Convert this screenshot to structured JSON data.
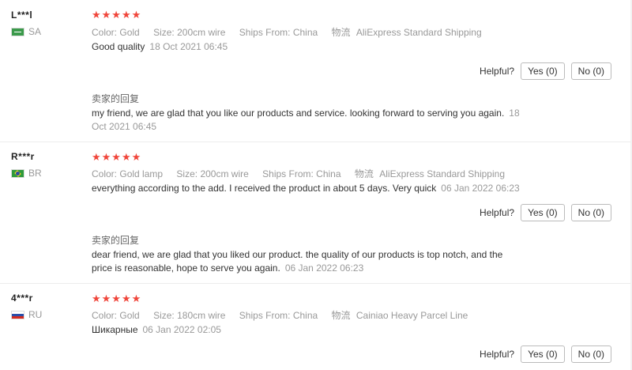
{
  "helpful_label": "Helpful?",
  "reviews": [
    {
      "user": "L***l",
      "country": "SA",
      "stars": "★★★★★",
      "color_label": "Color:",
      "color": "Gold",
      "size_label": "Size:",
      "size": "200cm wire",
      "ships_label": "Ships From:",
      "ships": "China",
      "shipping_label": "物流",
      "shipping": "AliExpress Standard Shipping",
      "text": "Good quality",
      "date": "18 Oct 2021 06:45",
      "yes": "Yes (0)",
      "no": "No (0)",
      "reply_title": "卖家的回复",
      "reply_text": "my friend, we are glad that you like our products and service. looking forward to serving you again.",
      "reply_date": "18 Oct 2021 06:45"
    },
    {
      "user": "R***r",
      "country": "BR",
      "stars": "★★★★★",
      "color_label": "Color:",
      "color": "Gold lamp",
      "size_label": "Size:",
      "size": "200cm wire",
      "ships_label": "Ships From:",
      "ships": "China",
      "shipping_label": "物流",
      "shipping": "AliExpress Standard Shipping",
      "text": "everything according to the add. I received the product in about 5 days. Very quick",
      "date": "06 Jan 2022 06:23",
      "yes": "Yes (0)",
      "no": "No (0)",
      "reply_title": "卖家的回复",
      "reply_text": "dear friend, we are glad that you liked our product. the quality of our products is top notch, and the price is reasonable, hope to serve you again.",
      "reply_date": "06 Jan 2022 06:23"
    },
    {
      "user": "4***r",
      "country": "RU",
      "stars": "★★★★★",
      "color_label": "Color:",
      "color": "Gold",
      "size_label": "Size:",
      "size": "180cm wire",
      "ships_label": "Ships From:",
      "ships": "China",
      "shipping_label": "物流",
      "shipping": "Cainiao Heavy Parcel Line",
      "text": "Шикарные",
      "date": "06 Jan 2022 02:05",
      "yes": "Yes (0)",
      "no": "No (0)"
    }
  ]
}
